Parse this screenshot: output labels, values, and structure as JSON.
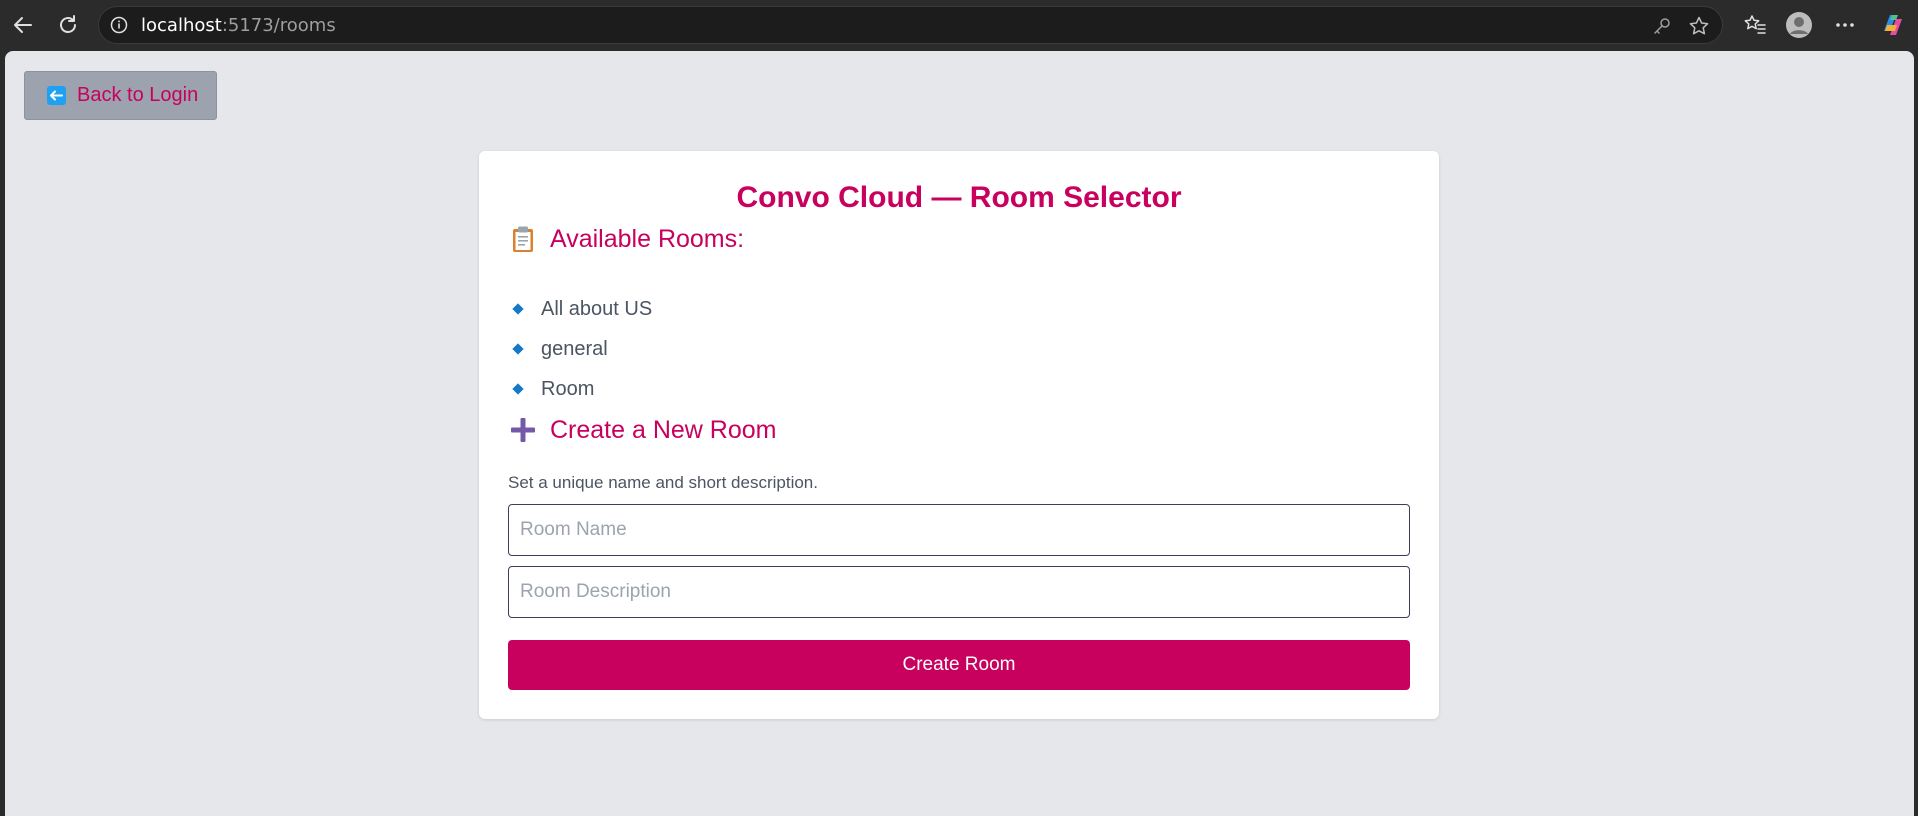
{
  "browser": {
    "url_host": "localhost",
    "url_rest": ":5173/rooms",
    "icons": [
      "back-arrow-icon",
      "reload-icon",
      "info-icon",
      "key-icon",
      "star-icon",
      "favorites-icon",
      "profile-icon",
      "more-icon",
      "copilot-icon"
    ]
  },
  "nav": {
    "back_label": "Back to Login",
    "back_icon": "left-arrow-icon"
  },
  "card": {
    "title": "Convo Cloud — Room Selector",
    "rooms_heading": "Available Rooms:",
    "rooms_icon": "clipboard-icon",
    "rooms": [
      {
        "name": "All about US"
      },
      {
        "name": "general"
      },
      {
        "name": "Room"
      }
    ],
    "create_heading": "Create a New Room",
    "create_icon": "plus-icon",
    "create_subtitle": "Set a unique name and short description.",
    "name_placeholder": "Room Name",
    "name_value": "",
    "desc_placeholder": "Room Description",
    "desc_value": "",
    "create_button": "Create Room"
  },
  "colors": {
    "accent": "#c8005e",
    "page_bg": "#e5e7eb",
    "back_button_bg": "#9ca3af",
    "bullet": "#1479c8"
  }
}
